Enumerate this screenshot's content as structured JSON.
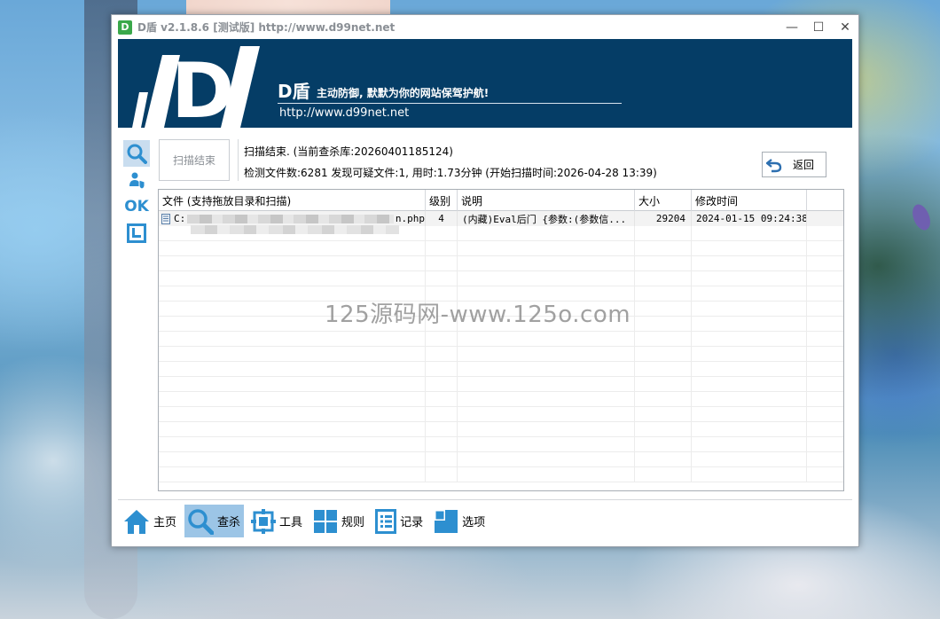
{
  "window": {
    "title": "D盾 v2.1.8.6 [测试版] http://www.d99net.net",
    "app_icon_letter": "D",
    "controls": {
      "minimize": "—",
      "maximize": "☐",
      "close": "✕"
    }
  },
  "banner": {
    "logo_letter": "D",
    "name": "D盾",
    "slogan": "主动防御, 默默为你的网站保驾护航!",
    "url": "http://www.d99net.net"
  },
  "sidebar": {
    "items": [
      {
        "icon": "search-icon",
        "active": true
      },
      {
        "icon": "user-shield-icon",
        "active": false
      },
      {
        "icon": "ok-icon",
        "label": "OK",
        "active": false
      },
      {
        "icon": "frame-icon",
        "active": false
      }
    ]
  },
  "status": {
    "button_label": "扫描结束",
    "line1": "扫描结束. (当前查杀库:20260401185124)",
    "line2": "检测文件数:6281 发现可疑文件:1, 用时:1.73分钟 (开始扫描时间:2026-04-28 13:39)",
    "back_label": "返回"
  },
  "table": {
    "columns": [
      "文件 (支持拖放目录和扫描)",
      "级别",
      "说明",
      "大小",
      "修改时间"
    ],
    "rows": [
      {
        "file_prefix": "C:",
        "file_suffix": "n.php",
        "level": "4",
        "desc": "(内藏)Eval后门 {参数:(参数信...",
        "size": "29204",
        "mtime": "2024-01-15 09:24:38"
      }
    ]
  },
  "watermark": "125源码网-www.125o.com",
  "nav": {
    "items": [
      {
        "label": "主页",
        "icon": "home-icon",
        "active": false
      },
      {
        "label": "查杀",
        "icon": "search-icon",
        "active": true
      },
      {
        "label": "工具",
        "icon": "tool-icon",
        "active": false
      },
      {
        "label": "规则",
        "icon": "grid-icon",
        "active": false
      },
      {
        "label": "记录",
        "icon": "log-icon",
        "active": false
      },
      {
        "label": "选项",
        "icon": "options-icon",
        "active": false
      }
    ]
  },
  "colors": {
    "banner": "#053d66",
    "accent": "#2d8fd0",
    "active_nav": "#9cc5e6"
  }
}
